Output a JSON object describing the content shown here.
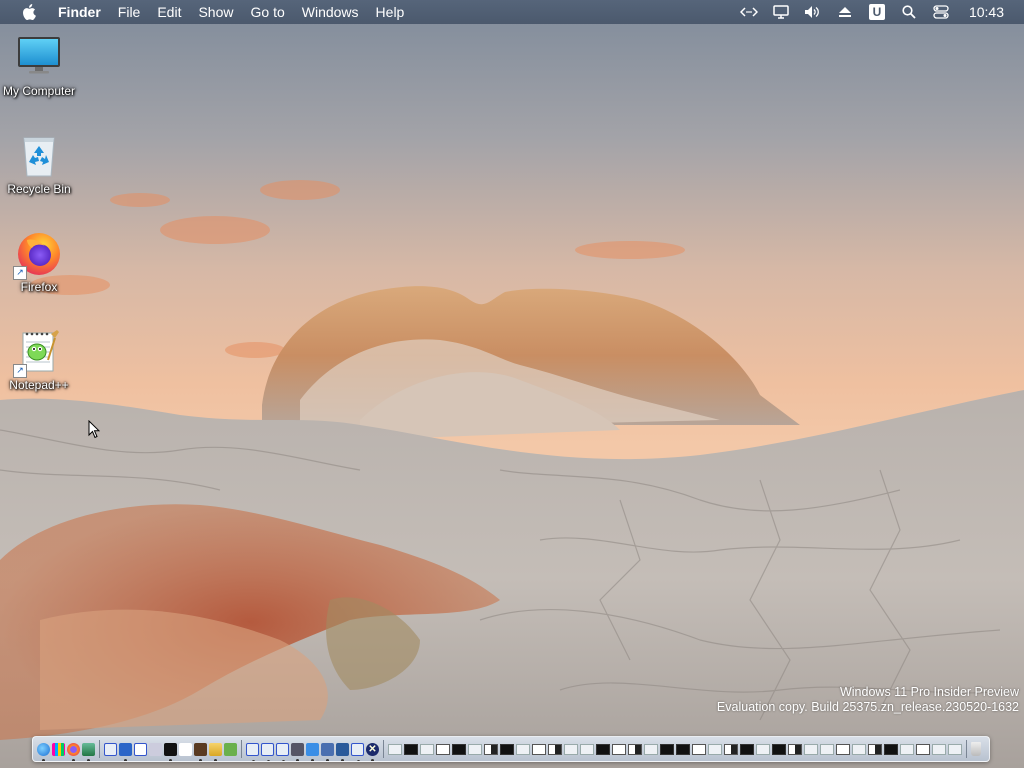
{
  "menubar": {
    "app_name": "Finder",
    "menus": [
      "File",
      "Edit",
      "Show",
      "Go to",
      "Windows",
      "Help"
    ],
    "status_icons": [
      "code-brackets-icon",
      "display-icon",
      "volume-icon",
      "eject-icon",
      "u-badge-icon",
      "search-icon",
      "control-center-icon"
    ],
    "clock": "10:43",
    "u_badge": "U"
  },
  "desktop": {
    "icons": [
      {
        "label": "My Computer",
        "icon": "monitor-icon"
      },
      {
        "label": "Recycle Bin",
        "icon": "recycle-bin-icon"
      },
      {
        "label": "Firefox",
        "icon": "firefox-icon",
        "shortcut": true
      },
      {
        "label": "Notepad++",
        "icon": "notepad-plus-plus-icon",
        "shortcut": true
      }
    ]
  },
  "watermark": {
    "line1": "Windows 11 Pro Insider Preview",
    "line2": "Evaluation copy. Build 25375.zn_release.230520-1632"
  },
  "dock": {
    "apps": [
      "finder-icon",
      "launchpad-icon",
      "firefox-icon",
      "app-icon",
      "window-icon",
      "word-icon",
      "doc-icon",
      "settings-icon",
      "terminal-icon",
      "media-icon",
      "folder-icon",
      "window-icon",
      "window-icon",
      "window-icon",
      "monitor-icon",
      "network-icon",
      "tools-icon",
      "server-icon",
      "window-icon",
      "close-icon"
    ],
    "colors": {
      "accent": "#1a5fb4",
      "menubar": "#4b596d"
    }
  }
}
